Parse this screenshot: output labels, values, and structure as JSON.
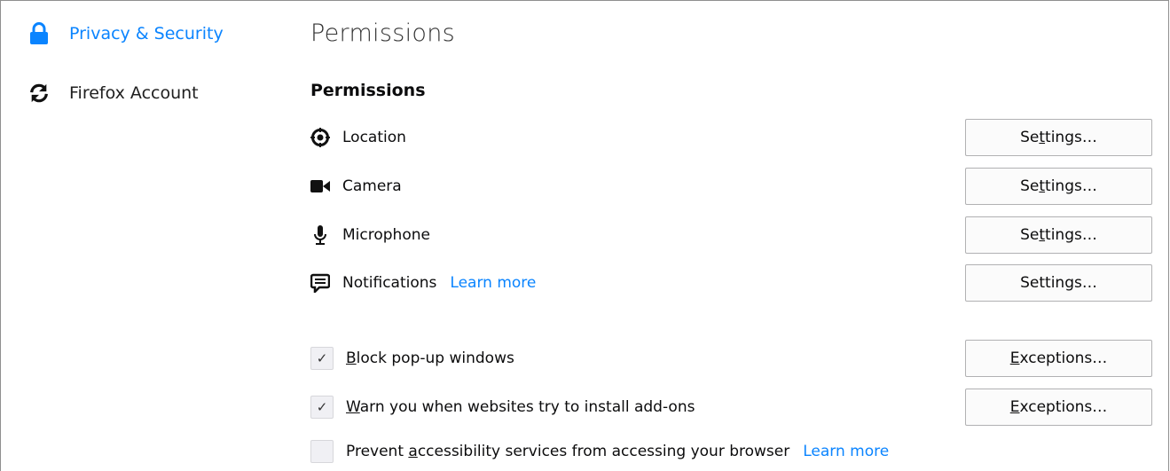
{
  "sidebar": {
    "items": [
      {
        "label": "Privacy & Security",
        "icon": "lock-icon",
        "active": true
      },
      {
        "label": "Firefox Account",
        "icon": "sync-icon",
        "active": false
      }
    ]
  },
  "page_title": "Permissions",
  "section_title": "Permissions",
  "permissions": [
    {
      "label": "Location",
      "icon": "location-icon",
      "button": {
        "pre": "Se",
        "key": "t",
        "post": "tings…"
      }
    },
    {
      "label": "Camera",
      "icon": "camera-icon",
      "button": {
        "pre": "Se",
        "key": "t",
        "post": "tings…"
      }
    },
    {
      "label": "Microphone",
      "icon": "microphone-icon",
      "button": {
        "pre": "Se",
        "key": "t",
        "post": "tings…"
      }
    },
    {
      "label": "Notifications",
      "icon": "notifications-icon",
      "link": "Learn more",
      "button": {
        "pre": "Settings…"
      }
    }
  ],
  "options": [
    {
      "checked": true,
      "key": "B",
      "rest": "lock pop-up windows",
      "button": {
        "key": "E",
        "rest": "xceptions…"
      }
    },
    {
      "checked": true,
      "key": "W",
      "rest": "arn you when websites try to install add-ons",
      "button": {
        "key": "E",
        "rest": "xceptions…"
      }
    },
    {
      "checked": false,
      "pre": "Prevent ",
      "key": "a",
      "rest": "ccessibility services from accessing your browser",
      "link": "Learn more"
    }
  ],
  "colors": {
    "accent": "#0a84ff",
    "border": "#b1b1b3"
  }
}
